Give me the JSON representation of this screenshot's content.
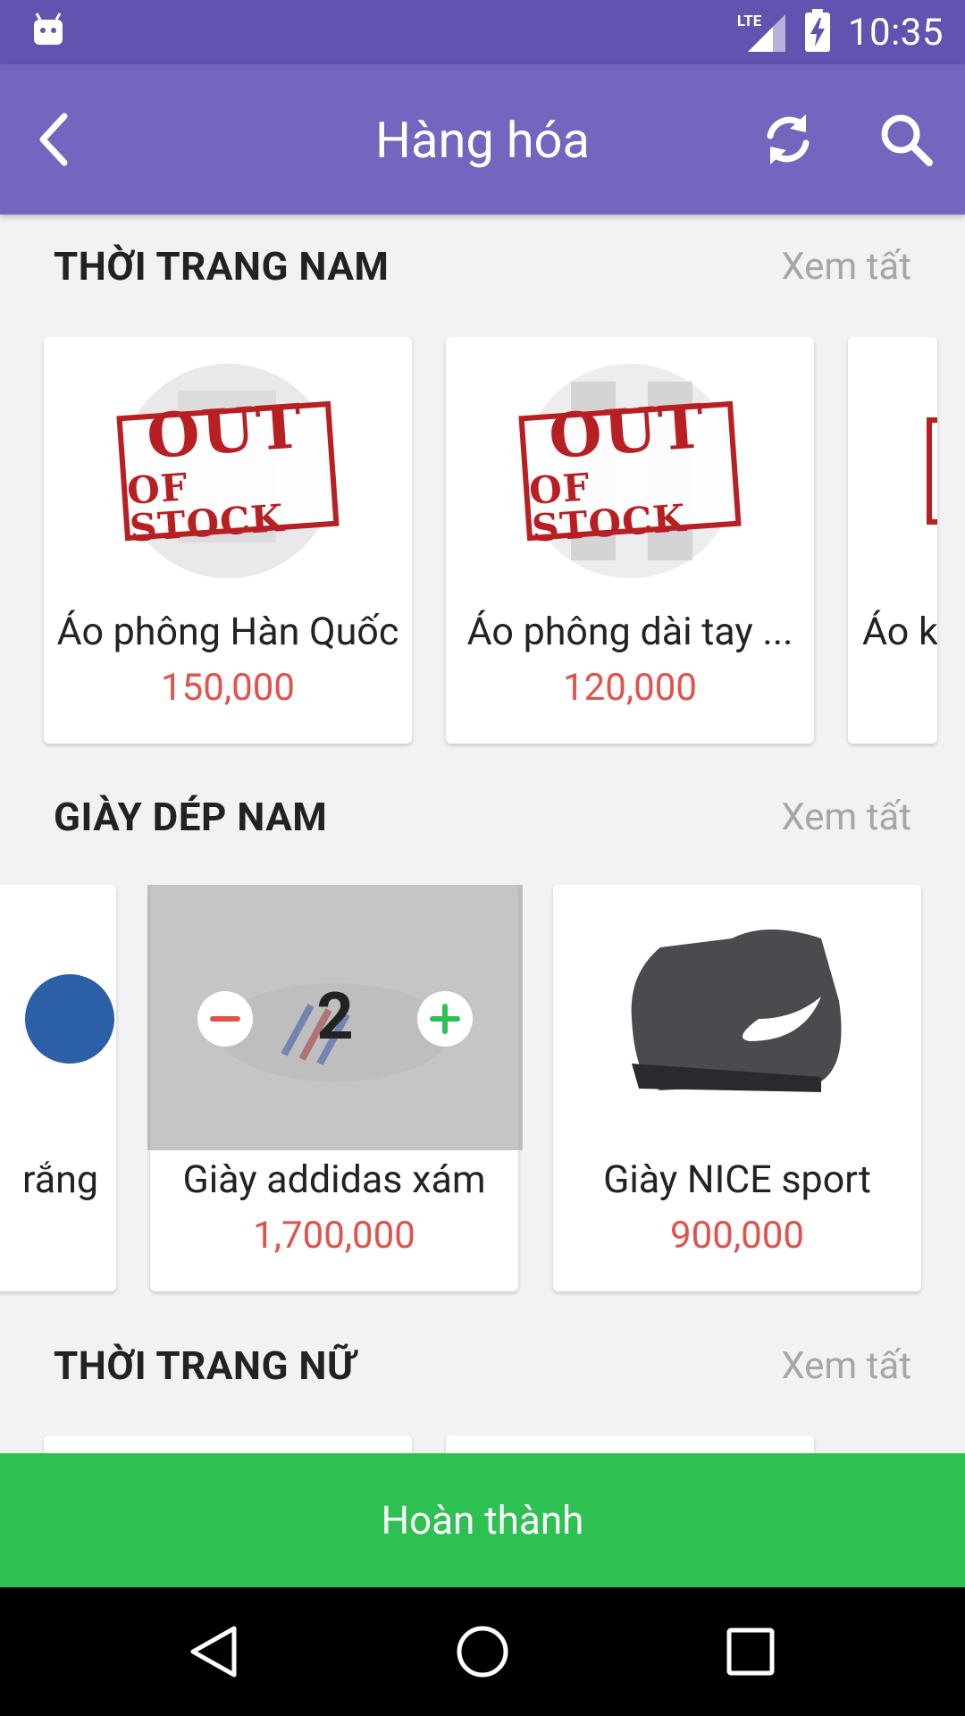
{
  "status_bar": {
    "time": "10:35",
    "network": "LTE"
  },
  "app_bar": {
    "title": "Hàng hóa"
  },
  "sections": [
    {
      "title": "THỜI TRANG NAM",
      "see_all": "Xem tất",
      "products": [
        {
          "name": "Áo phông Hàn Quốc",
          "price": "150,000",
          "badge_l1": "OUT",
          "badge_l2": "OF STOCK"
        },
        {
          "name": "Áo phông dài tay ...",
          "price": "120,000",
          "badge_l1": "OUT",
          "badge_l2": "OF STOCK"
        },
        {
          "name": "Áo k"
        }
      ]
    },
    {
      "title": "GIÀY DÉP NAM",
      "see_all": "Xem tất",
      "products": [
        {
          "name": "rắng"
        },
        {
          "name": "Giày addidas xám",
          "price": "1,700,000",
          "quantity": "2"
        },
        {
          "name": "Giày NICE sport",
          "price": "900,000"
        }
      ]
    },
    {
      "title": "THỜI TRANG NỮ",
      "see_all": "Xem tất"
    }
  ],
  "finish_button": "Hoàn thành",
  "colors": {
    "status_bar": "#6353b1",
    "app_bar": "#7266bf",
    "price": "#e0524c",
    "finish": "#2cc151"
  }
}
